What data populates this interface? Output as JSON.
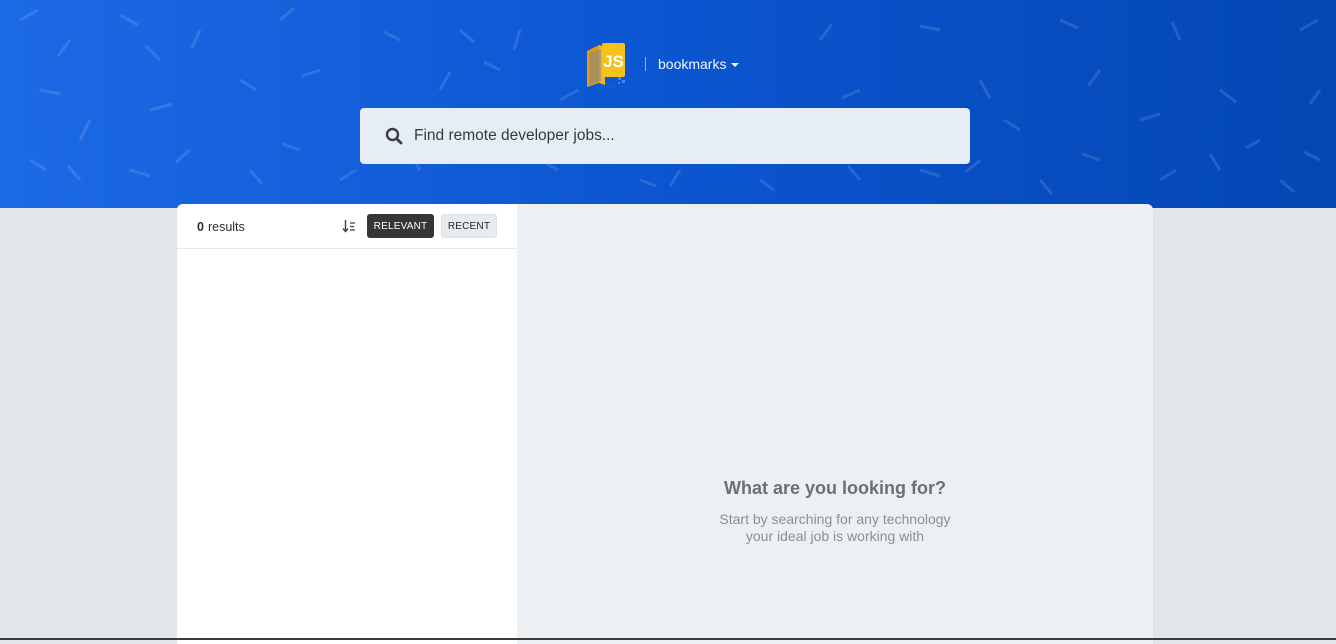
{
  "header": {
    "logo_text": "JS",
    "bookmarks_label": "bookmarks"
  },
  "search": {
    "placeholder": "Find remote developer jobs..."
  },
  "results": {
    "count": "0",
    "label": "results"
  },
  "sort": {
    "relevant_label": "RELEVANT",
    "recent_label": "RECENT",
    "active": "RELEVANT"
  },
  "empty_state": {
    "title": "What are you looking for?",
    "line1": "Start by searching for any technology",
    "line2": "your ideal job is working with"
  },
  "colors": {
    "brand_blue": "#1d6ae5",
    "brand_blue_dark": "#0447b4",
    "logo_yellow": "#f4c21b",
    "active_button": "#353638"
  },
  "icons": [
    "logo-icon",
    "chevron-down-icon",
    "search-icon",
    "sort-descending-icon"
  ]
}
